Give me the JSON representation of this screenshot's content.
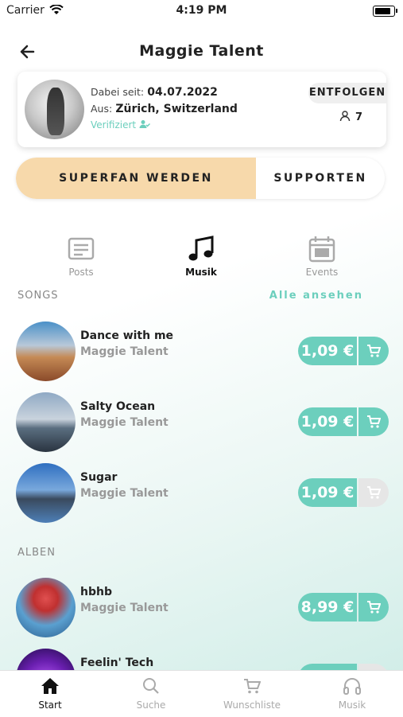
{
  "status": {
    "carrier": "Carrier",
    "time": "4:19 PM"
  },
  "header": {
    "title": "Maggie Talent"
  },
  "profile": {
    "since_label": "Dabei seit:",
    "since_value": "04.07.2022",
    "from_label": "Aus:",
    "from_value": "Zürich, Switzerland",
    "verified": "Verifiziert",
    "unfollow_label": "ENTFOLGEN",
    "followers": "7"
  },
  "cta": {
    "superfan": "SUPERFAN WERDEN",
    "support": "SUPPORTEN"
  },
  "tabs": [
    {
      "label": "Posts",
      "icon": "posts-icon"
    },
    {
      "label": "Musik",
      "icon": "music-note-icon"
    },
    {
      "label": "Events",
      "icon": "calendar-icon"
    }
  ],
  "songs": {
    "heading": "SONGS",
    "see_all": "Alle ansehen",
    "items": [
      {
        "title": "Dance with me",
        "artist": "Maggie Talent",
        "price": "1,09 €",
        "cart_enabled": true
      },
      {
        "title": "Salty Ocean",
        "artist": "Maggie Talent",
        "price": "1,09 €",
        "cart_enabled": true
      },
      {
        "title": "Sugar",
        "artist": "Maggie Talent",
        "price": "1,09 €",
        "cart_enabled": false
      }
    ]
  },
  "albums": {
    "heading": "ALBEN",
    "items": [
      {
        "title": "hbhb",
        "artist": "Maggie Talent",
        "price": "8,99 €",
        "cart_enabled": true
      },
      {
        "title": "Feelin' Tech",
        "artist": "",
        "price": "",
        "cart_enabled": false
      }
    ]
  },
  "nav": [
    {
      "label": "Start",
      "icon": "home-icon"
    },
    {
      "label": "Suche",
      "icon": "search-icon"
    },
    {
      "label": "Wunschliste",
      "icon": "cart-icon"
    },
    {
      "label": "Musik",
      "icon": "headphones-icon"
    }
  ],
  "colors": {
    "accent": "#6ccfbd",
    "superfan": "#f7d9ab"
  }
}
